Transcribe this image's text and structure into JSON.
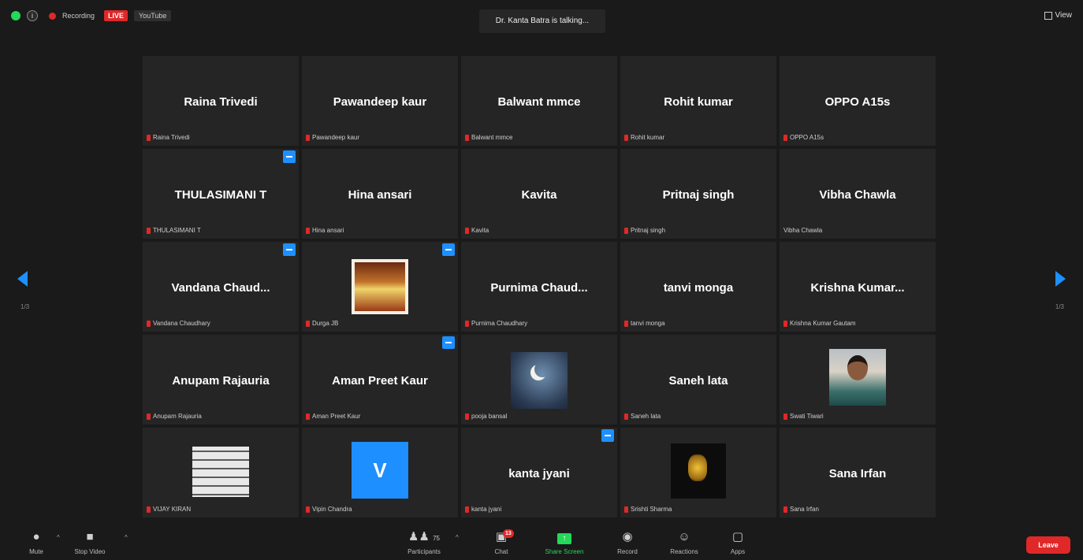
{
  "topbar": {
    "recording_label": "Recording",
    "live_badge": "LIVE",
    "live_platform": "YouTube",
    "talking_indicator": "Dr. Kanta Batra is talking...",
    "view_label": "View"
  },
  "tiles": [
    {
      "name": "Raina Trivedi",
      "label": "Raina Trivedi"
    },
    {
      "name": "Pawandeep kaur",
      "label": "Pawandeep kaur"
    },
    {
      "name": "Balwant mmce",
      "label": "Balwant mmce"
    },
    {
      "name": "Rohit kumar",
      "label": "Rohit kumar"
    },
    {
      "name": "OPPO A15s",
      "label": "OPPO A15s"
    },
    {
      "name": "THULASIMANI T",
      "label": "THULASIMANI T"
    },
    {
      "name": "Hina ansari",
      "label": "Hina ansari"
    },
    {
      "name": "Kavita",
      "label": "Kavita"
    },
    {
      "name": "Pritnaj singh",
      "label": "Pritnaj singh"
    },
    {
      "name": "Vibha Chawla",
      "label": "Vibha Chawla"
    },
    {
      "name": "Vandana Chaud...",
      "label": "Vandana Chaudhary"
    },
    {
      "name": "",
      "label": "Durga JB"
    },
    {
      "name": "Purnima Chaud...",
      "label": "Purnima Chaudhary"
    },
    {
      "name": "tanvi monga",
      "label": "tanvi monga"
    },
    {
      "name": "Krishna Kumar...",
      "label": "Krishna Kumar Gautam"
    },
    {
      "name": "Anupam Rajauria",
      "label": "Anupam Rajauria"
    },
    {
      "name": "Aman Preet Kaur",
      "label": "Aman Preet Kaur"
    },
    {
      "name": "",
      "label": "pooja bansal"
    },
    {
      "name": "Saneh lata",
      "label": "Saneh lata"
    },
    {
      "name": "",
      "label": "Swati Tiwari"
    },
    {
      "name": "",
      "label": "VIJAY KIRAN"
    },
    {
      "name": "",
      "label": "Vipin Chandra"
    },
    {
      "name": "kanta jyani",
      "label": "kanta jyani"
    },
    {
      "name": "",
      "label": "Srishti Sharma"
    },
    {
      "name": "Sana Irfan",
      "label": "Sana Irfan"
    }
  ],
  "avatar_letter": "V",
  "pagination": {
    "left": "1/3",
    "right": "1/3"
  },
  "toolbar": {
    "mute": "Mute",
    "stop_video": "Stop Video",
    "participants": "Participants",
    "participants_count": "75",
    "chat": "Chat",
    "chat_badge": "13",
    "share_screen": "Share Screen",
    "record": "Record",
    "reactions": "Reactions",
    "apps": "Apps",
    "leave": "Leave"
  },
  "colors": {
    "background": "#1a1a1a",
    "tile": "#252525",
    "accent_blue": "#1e8fff",
    "live_red": "#e02828",
    "share_green": "#23d959"
  }
}
